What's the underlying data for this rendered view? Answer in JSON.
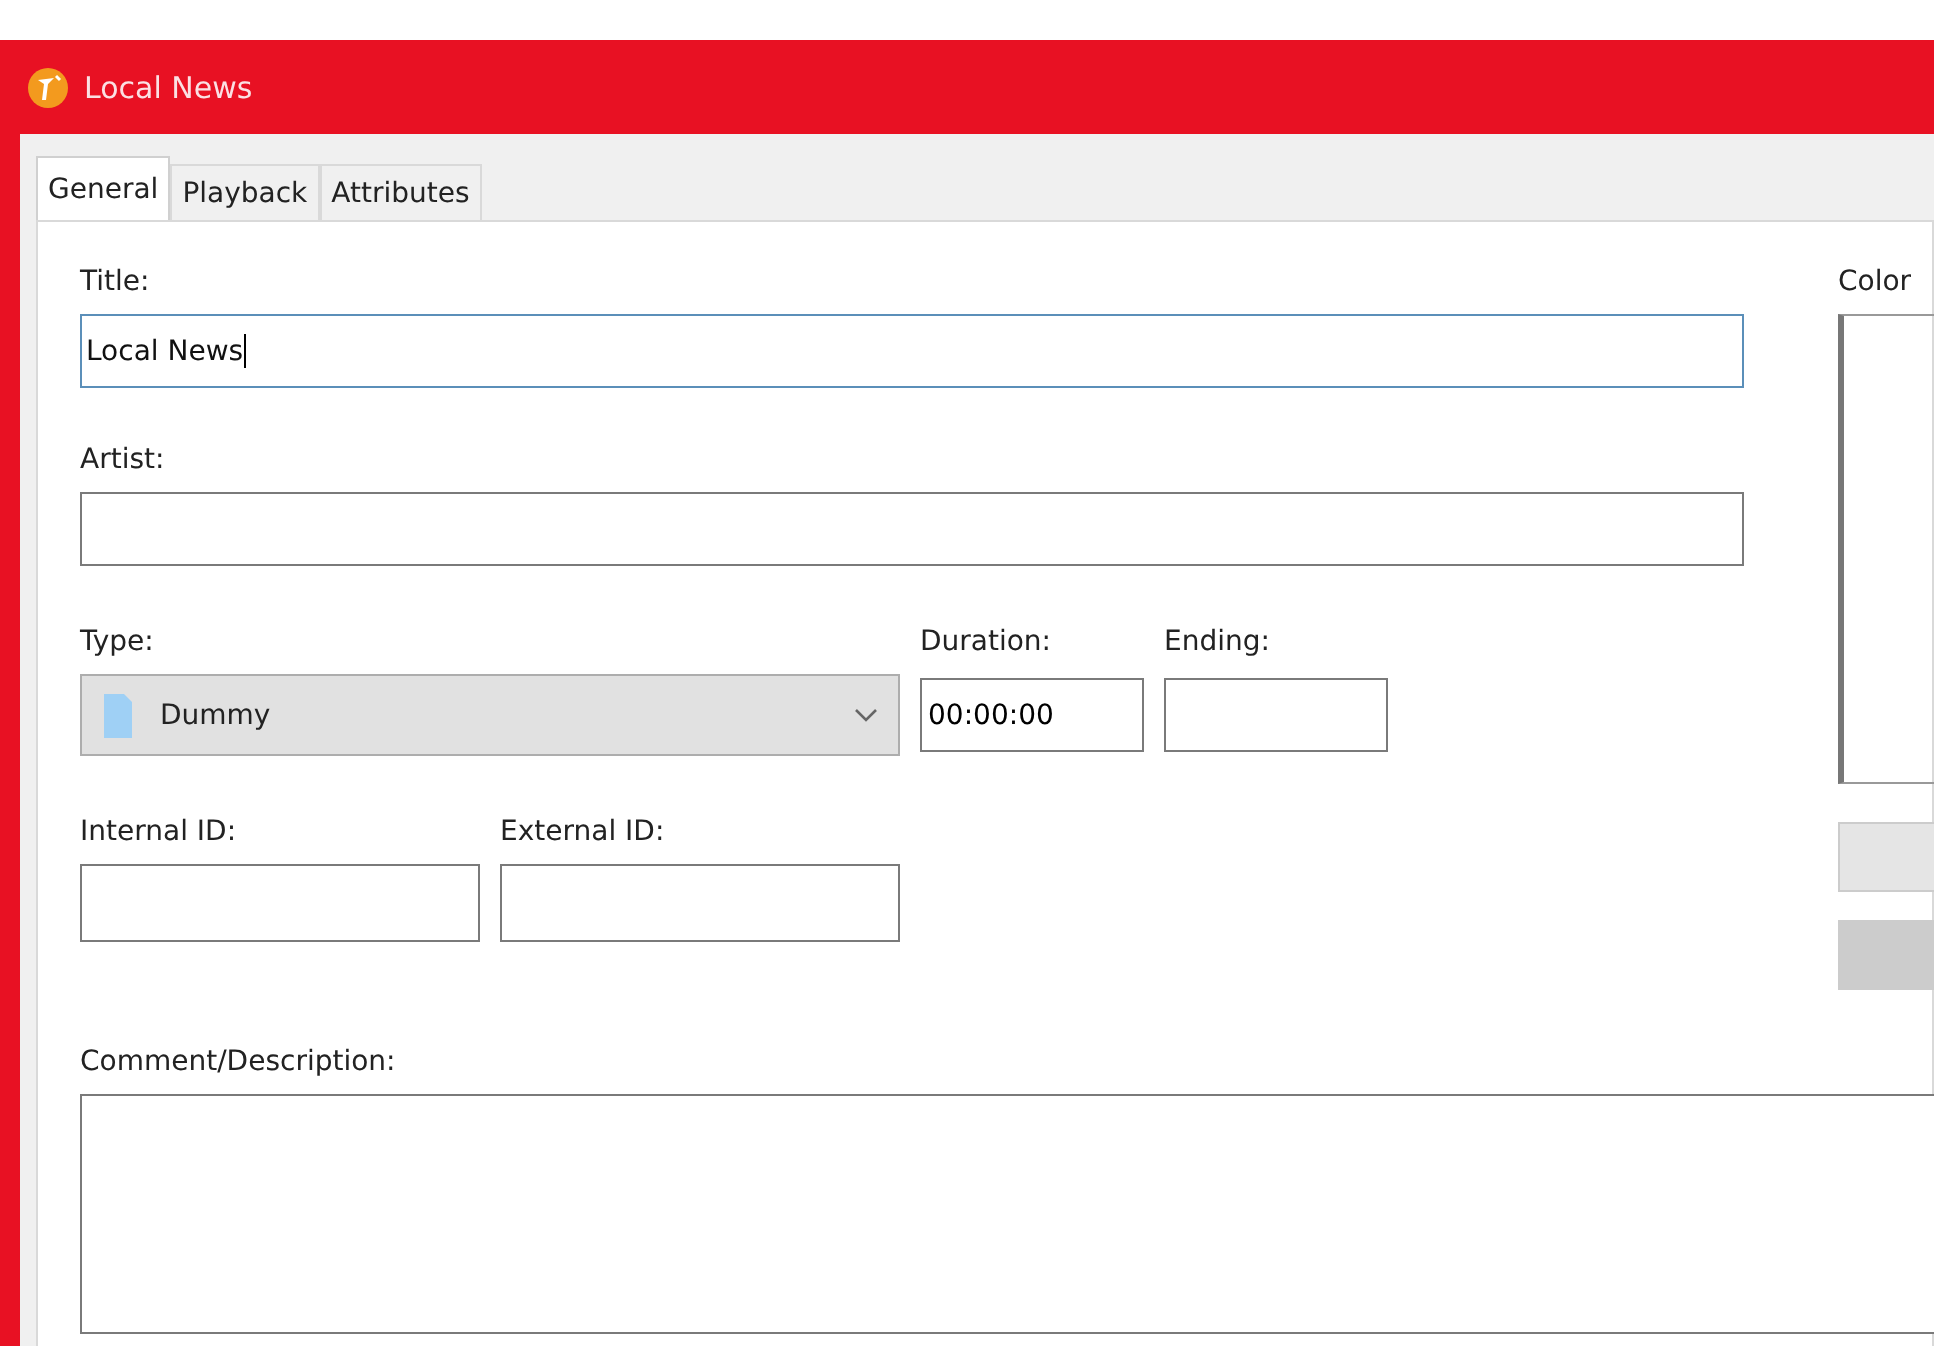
{
  "window": {
    "title": "Local News"
  },
  "tabs": [
    {
      "label": "General",
      "selected": true
    },
    {
      "label": "Playback",
      "selected": false
    },
    {
      "label": "Attributes",
      "selected": false
    }
  ],
  "title": {
    "label": "Title:",
    "value": "Local News",
    "focused": true
  },
  "artist": {
    "label": "Artist:",
    "focused": false
  },
  "type": {
    "label": "Type:",
    "value": "Dummy"
  },
  "duration": {
    "label": "Duration:",
    "value": "00:00:00"
  },
  "ending": {
    "label": "Ending:"
  },
  "internal_id": {
    "label": "Internal ID:"
  },
  "external_id": {
    "label": "External ID:"
  },
  "comment": {
    "label": "Comment/Description:"
  },
  "color": {
    "label": "Color"
  }
}
